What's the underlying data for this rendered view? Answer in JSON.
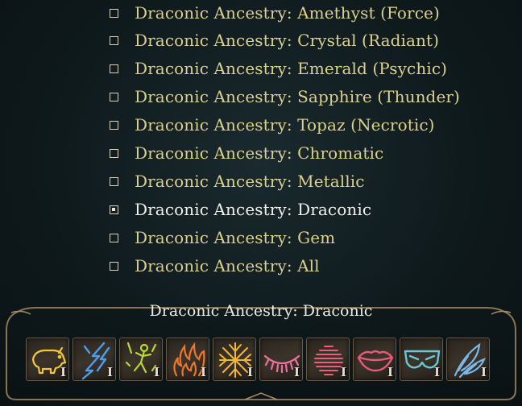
{
  "options": [
    {
      "label": "Draconic Ancestry: Amethyst (Force)",
      "checked": false
    },
    {
      "label": "Draconic Ancestry: Crystal (Radiant)",
      "checked": false
    },
    {
      "label": "Draconic Ancestry: Emerald (Psychic)",
      "checked": false
    },
    {
      "label": "Draconic Ancestry: Sapphire (Thunder)",
      "checked": false
    },
    {
      "label": "Draconic Ancestry: Topaz (Necrotic)",
      "checked": false
    },
    {
      "label": "Draconic Ancestry: Chromatic",
      "checked": false
    },
    {
      "label": "Draconic Ancestry: Metallic",
      "checked": false
    },
    {
      "label": "Draconic Ancestry: Draconic",
      "checked": true
    },
    {
      "label": "Draconic Ancestry: Gem",
      "checked": false
    },
    {
      "label": "Draconic Ancestry: All",
      "checked": false
    }
  ],
  "panel": {
    "title": "Draconic Ancestry: Draconic"
  },
  "spell_slots": [
    {
      "icon": "boar-icon",
      "level": "I",
      "color": "#f2c83a"
    },
    {
      "icon": "lightning-bolt-icon",
      "level": "I",
      "color": "#4a9ff0"
    },
    {
      "icon": "acid-figure-icon",
      "level": "I",
      "color": "#b8d83a"
    },
    {
      "icon": "flames-icon",
      "level": "I",
      "color": "#f0772a"
    },
    {
      "icon": "frost-shard-icon",
      "level": "I",
      "color": "#f5b43a"
    },
    {
      "icon": "closed-eye-icon",
      "level": "I",
      "color": "#f070a0"
    },
    {
      "icon": "sound-wave-icon",
      "level": "I",
      "color": "#e8607a"
    },
    {
      "icon": "lips-icon",
      "level": "I",
      "color": "#e85a7a"
    },
    {
      "icon": "mask-icon",
      "level": "I",
      "color": "#6ac8d8"
    },
    {
      "icon": "feathers-icon",
      "level": "I",
      "color": "#7ab8e8"
    }
  ]
}
